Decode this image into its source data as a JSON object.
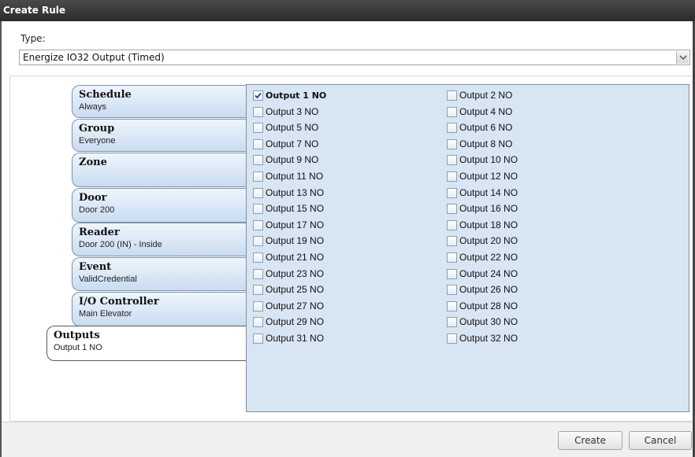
{
  "window": {
    "title": "Create Rule"
  },
  "type_field": {
    "label": "Type:",
    "value": "Energize IO32 Output (Timed)"
  },
  "tabs": [
    {
      "title": "Schedule",
      "subtitle": "Always"
    },
    {
      "title": "Group",
      "subtitle": "Everyone"
    },
    {
      "title": "Zone",
      "subtitle": ""
    },
    {
      "title": "Door",
      "subtitle": "Door 200"
    },
    {
      "title": "Reader",
      "subtitle": "Door 200 (IN) - Inside"
    },
    {
      "title": "Event",
      "subtitle": "ValidCredential"
    },
    {
      "title": "I/O Controller",
      "subtitle": "Main Elevator"
    },
    {
      "title": "Outputs",
      "subtitle": "Output 1 NO",
      "active": true
    }
  ],
  "outputs": [
    {
      "label": "Output 1 NO",
      "checked": true
    },
    {
      "label": "Output 2 NO",
      "checked": false
    },
    {
      "label": "Output 3 NO",
      "checked": false
    },
    {
      "label": "Output 4 NO",
      "checked": false
    },
    {
      "label": "Output 5 NO",
      "checked": false
    },
    {
      "label": "Output 6 NO",
      "checked": false
    },
    {
      "label": "Output 7 NO",
      "checked": false
    },
    {
      "label": "Output 8 NO",
      "checked": false
    },
    {
      "label": "Output 9 NO",
      "checked": false
    },
    {
      "label": "Output 10 NO",
      "checked": false
    },
    {
      "label": "Output 11 NO",
      "checked": false
    },
    {
      "label": "Output 12 NO",
      "checked": false
    },
    {
      "label": "Output 13 NO",
      "checked": false
    },
    {
      "label": "Output 14 NO",
      "checked": false
    },
    {
      "label": "Output 15 NO",
      "checked": false
    },
    {
      "label": "Output 16 NO",
      "checked": false
    },
    {
      "label": "Output 17 NO",
      "checked": false
    },
    {
      "label": "Output 18 NO",
      "checked": false
    },
    {
      "label": "Output 19 NO",
      "checked": false
    },
    {
      "label": "Output 20 NO",
      "checked": false
    },
    {
      "label": "Output 21 NO",
      "checked": false
    },
    {
      "label": "Output 22 NO",
      "checked": false
    },
    {
      "label": "Output 23 NO",
      "checked": false
    },
    {
      "label": "Output 24 NO",
      "checked": false
    },
    {
      "label": "Output 25 NO",
      "checked": false
    },
    {
      "label": "Output 26 NO",
      "checked": false
    },
    {
      "label": "Output 27 NO",
      "checked": false
    },
    {
      "label": "Output 28 NO",
      "checked": false
    },
    {
      "label": "Output 29 NO",
      "checked": false
    },
    {
      "label": "Output 30 NO",
      "checked": false
    },
    {
      "label": "Output 31 NO",
      "checked": false
    },
    {
      "label": "Output 32 NO",
      "checked": false
    }
  ],
  "buttons": {
    "create": "Create",
    "cancel": "Cancel"
  },
  "icons": {
    "dropdown": "chevron-down-icon",
    "check": "checkmark-icon"
  },
  "colors": {
    "titlebar": "#333333",
    "panel": "#d8e5f2",
    "tab": "#c9dcf1"
  }
}
